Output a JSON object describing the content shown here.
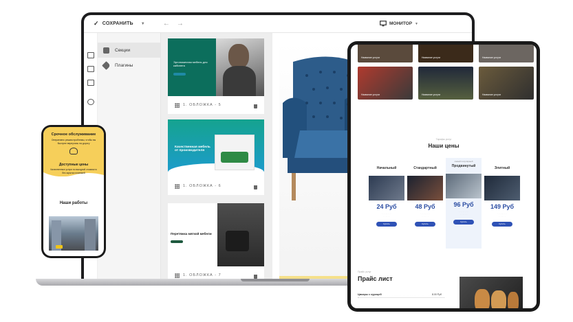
{
  "editor": {
    "save_label": "СОХРАНИТЬ",
    "device_label": "МОНИТОР",
    "sidebar_items": [
      {
        "label": "Секции"
      },
      {
        "label": "Плагины"
      }
    ],
    "cards": [
      {
        "label": "1. ОБЛОЖКА - 5",
        "preview_title": "Эргономичная мебель для кабинета"
      },
      {
        "label": "1. ОБЛОЖКА - 6",
        "preview_title": "Качественная мебель от производителя"
      },
      {
        "label": "1. ОБЛОЖКА - 7",
        "preview_title": "Перетяжка мягкой мебели"
      }
    ]
  },
  "phone": {
    "heading_service": "Срочное обслуживание",
    "service_text": "Оперативно решим проблемы, чтобы вы быстрее вернулись на дорогу",
    "heading_prices": "Доступные цены",
    "prices_text": "Качественные услуги по выгодной стоимости без скрытых платежей",
    "heading_works": "Наши работы"
  },
  "tablet": {
    "tile_caption": "Название услуги",
    "prices_kicker": "Тарифы услуг",
    "prices_heading": "Наши цены",
    "popular_badge": "самый популярный",
    "plans": [
      {
        "name": "Начальный",
        "price": "24 Руб"
      },
      {
        "name": "Стандартный",
        "price": "48 Руб"
      },
      {
        "name": "Продвинутый",
        "price": "96 Руб"
      },
      {
        "name": "Элитный",
        "price": "149 Руб"
      }
    ],
    "plan_button": "Купить",
    "pricelist_kicker": "Прайс услуг",
    "pricelist_heading": "Прайс лист",
    "pricelist_item": "Цвоары с курицей",
    "pricelist_price": "8.00 Руб"
  }
}
